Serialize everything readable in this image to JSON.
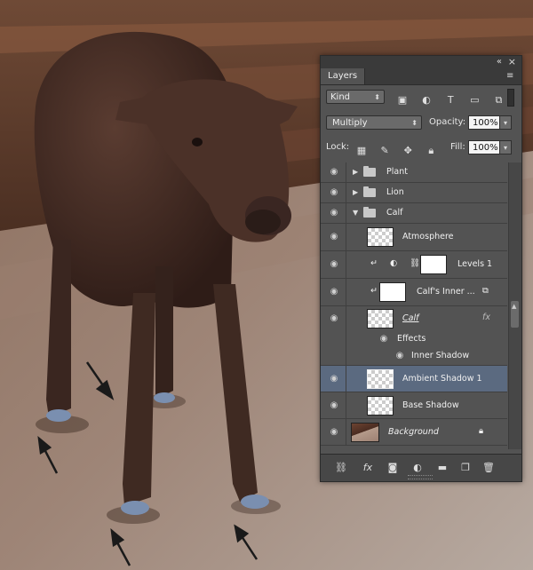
{
  "panel": {
    "tab_label": "Layers",
    "double_arrow_icon": "«",
    "close_icon": "×",
    "menu_icon": "≡"
  },
  "filter_row": {
    "kind_label": "Kind",
    "kind_arrow": "⬍",
    "icons": [
      "image-filter-icon",
      "adjustment-filter-icon",
      "type-filter-icon",
      "shape-filter-icon",
      "smart-object-filter-icon"
    ]
  },
  "blend_row": {
    "blend_mode": "Multiply",
    "opacity_label": "Opacity:",
    "opacity_value": "100%"
  },
  "lock_row": {
    "lock_label": "Lock:",
    "fill_label": "Fill:",
    "fill_value": "100%"
  },
  "layers": [
    {
      "name": "Plant",
      "type": "group",
      "expanded": false
    },
    {
      "name": "Lion",
      "type": "group",
      "expanded": false
    },
    {
      "name": "Calf",
      "type": "group",
      "expanded": true
    },
    {
      "name": "Atmosphere",
      "type": "layer"
    },
    {
      "name": "Levels 1",
      "type": "adjustment"
    },
    {
      "name": "Calf's Inner ...",
      "type": "layer"
    },
    {
      "name": "Calf",
      "type": "layer",
      "fx": "fx"
    },
    {
      "name": "Effects",
      "type": "effects-header"
    },
    {
      "name": "Inner Shadow",
      "type": "effect"
    },
    {
      "name": "Ambient Shadow 1",
      "type": "layer",
      "selected": true
    },
    {
      "name": "Base Shadow",
      "type": "layer"
    },
    {
      "name": "Background",
      "type": "background"
    }
  ],
  "bottom_icons": [
    "link-layers-icon",
    "fx-icon",
    "add-mask-icon",
    "new-adjustment-icon",
    "new-group-icon",
    "new-layer-icon",
    "delete-layer-icon"
  ],
  "colors": {
    "panel_bg": "#535353",
    "selected_row": "#5b6a80",
    "arrow": "#1a1a1a"
  }
}
